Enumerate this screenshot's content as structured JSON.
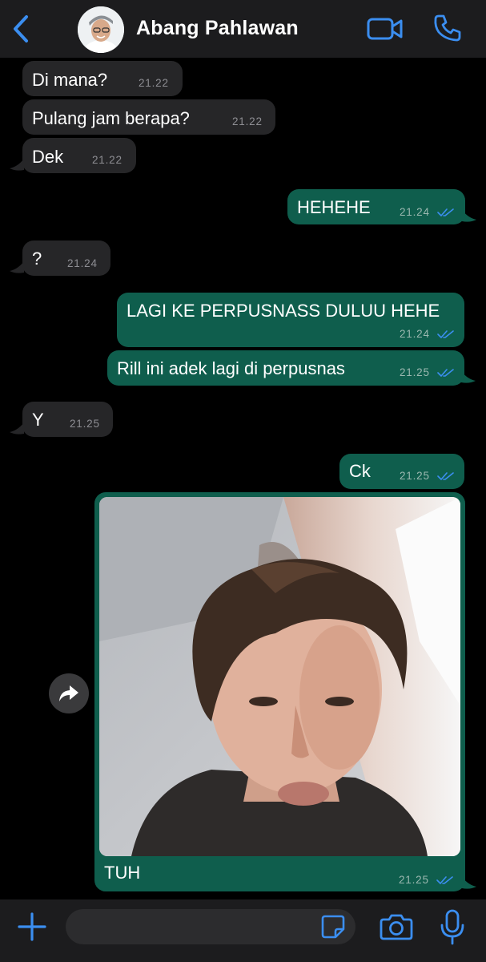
{
  "header": {
    "contact_name": "Abang Pahlawan",
    "back_icon": "chevron-left-icon",
    "video_icon": "video-camera-icon",
    "call_icon": "phone-icon"
  },
  "colors": {
    "accent": "#3b8ef0",
    "incoming_bubble": "#262628",
    "outgoing_bubble": "#0f5e4d",
    "background": "#000000"
  },
  "messages": [
    {
      "direction": "in",
      "text": "Di mana?",
      "time": "21.22"
    },
    {
      "direction": "in",
      "text": "Pulang jam berapa?",
      "time": "21.22"
    },
    {
      "direction": "in",
      "text": "Dek",
      "time": "21.22"
    },
    {
      "direction": "out",
      "text": "HEHEHE",
      "time": "21.24",
      "status": "read"
    },
    {
      "direction": "in",
      "text": "?",
      "time": "21.24"
    },
    {
      "direction": "out",
      "text": "LAGI KE PERPUSNASS DULUU HEHE",
      "time": "21.24",
      "status": "read"
    },
    {
      "direction": "out",
      "text": "Rill ini adek lagi di perpusnas",
      "time": "21.25",
      "status": "read"
    },
    {
      "direction": "in",
      "text": "Y",
      "time": "21.25"
    },
    {
      "direction": "out",
      "text": "Ck",
      "time": "21.25",
      "status": "read"
    },
    {
      "direction": "out",
      "type": "photo",
      "caption": "TUH",
      "time": "21.25",
      "status": "read"
    }
  ],
  "input_bar": {
    "placeholder": "",
    "plus_icon": "plus-icon",
    "sticker_icon": "sticker-icon",
    "camera_icon": "camera-icon",
    "mic_icon": "microphone-icon"
  }
}
